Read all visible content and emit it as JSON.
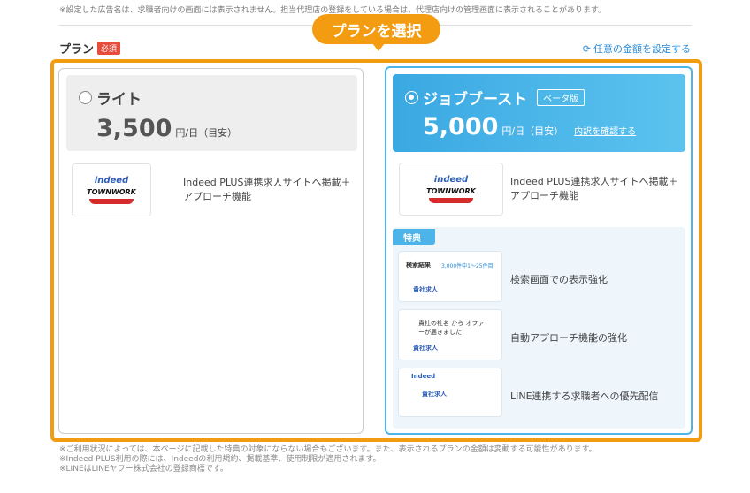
{
  "top_note": "※設定した広告名は、求職者向けの画面には表示されません。担当代理店の登録をしている場合は、代理店向けの管理画面に表示されることがあります。",
  "section": {
    "title": "プラン",
    "required": "必須"
  },
  "callout": "プランを選択",
  "custom_amount_link": "任意の金額を設定する",
  "plans": {
    "lite": {
      "name": "ライト",
      "price": "3,500",
      "unit": "円/日（目安）",
      "feature": "Indeed PLUS連携求人サイトへ掲載＋アプローチ機能",
      "selected": false
    },
    "boost": {
      "name": "ジョブブースト",
      "badge": "ベータ版",
      "price": "5,000",
      "unit": "円/日（目安）",
      "detail_link": "内訳を確認する",
      "feature": "Indeed PLUS連携求人サイトへ掲載＋アプローチ機能",
      "selected": true,
      "perks_label": "特典",
      "perks": [
        {
          "text": "検索画面での表示強化",
          "thumb_title": "検索結果",
          "thumb_sub": "3,000件中1〜25件目",
          "thumb_job": "貴社求人"
        },
        {
          "text": "自動アプローチ機能の強化",
          "thumb_title": "貴社の社名 から オファーが届きました",
          "thumb_job": "貴社求人"
        },
        {
          "text": "LINE連携する求職者への優先配信",
          "thumb_title": "Indeed",
          "thumb_job": "貴社求人"
        }
      ]
    }
  },
  "logos": {
    "indeed": "indeed",
    "townwork": "TOWNWORK"
  },
  "footnotes": [
    "※ご利用状況によっては、本ページに記載した特典の対象にならない場合もございます。また、表示されるプランの金額は変動する可能性があります。",
    "※Indeed PLUS利用の際には、Indeedの利用規約、掲載基準、使用制限が適用されます。",
    "※LINEはLINEヤフー株式会社の登録商標です。"
  ],
  "colors": {
    "accent": "#f39c12",
    "brand_blue": "#4cb4e8",
    "required_red": "#e74c3c"
  }
}
